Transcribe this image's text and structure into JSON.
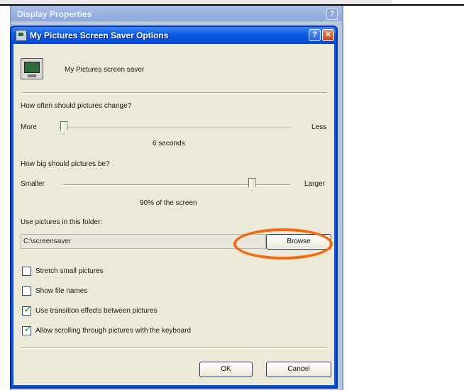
{
  "background_window": {
    "title": "Display Properties",
    "help_glyph": "?"
  },
  "dialog": {
    "title": "My Pictures Screen Saver Options",
    "help_glyph": "?",
    "close_glyph": "✕",
    "description": "My Pictures screen saver",
    "change": {
      "question": "How often should pictures change?",
      "left_label": "More",
      "right_label": "Less",
      "value_text": "6 seconds",
      "slider_fraction": 0.02
    },
    "size": {
      "question": "How big should pictures be?",
      "left_label": "Smaller",
      "right_label": "Larger",
      "value_text": "90% of the screen",
      "slider_fraction": 0.83
    },
    "folder": {
      "label": "Use pictures in this folder:",
      "path": "C:\\screensaver",
      "browse_label": "Browse"
    },
    "options": [
      {
        "label": "Stretch small pictures",
        "checked": false
      },
      {
        "label": "Show file names",
        "checked": false
      },
      {
        "label": "Use transition effects between pictures",
        "checked": true
      },
      {
        "label": "Allow scrolling through pictures with the keyboard",
        "checked": true
      }
    ],
    "ok_label": "OK",
    "cancel_label": "Cancel",
    "check_glyph": "✓"
  },
  "colors": {
    "highlight_ring": "#f26a12",
    "title_bar": "#0a5ae3",
    "dialog_bg": "#ece9d8"
  }
}
